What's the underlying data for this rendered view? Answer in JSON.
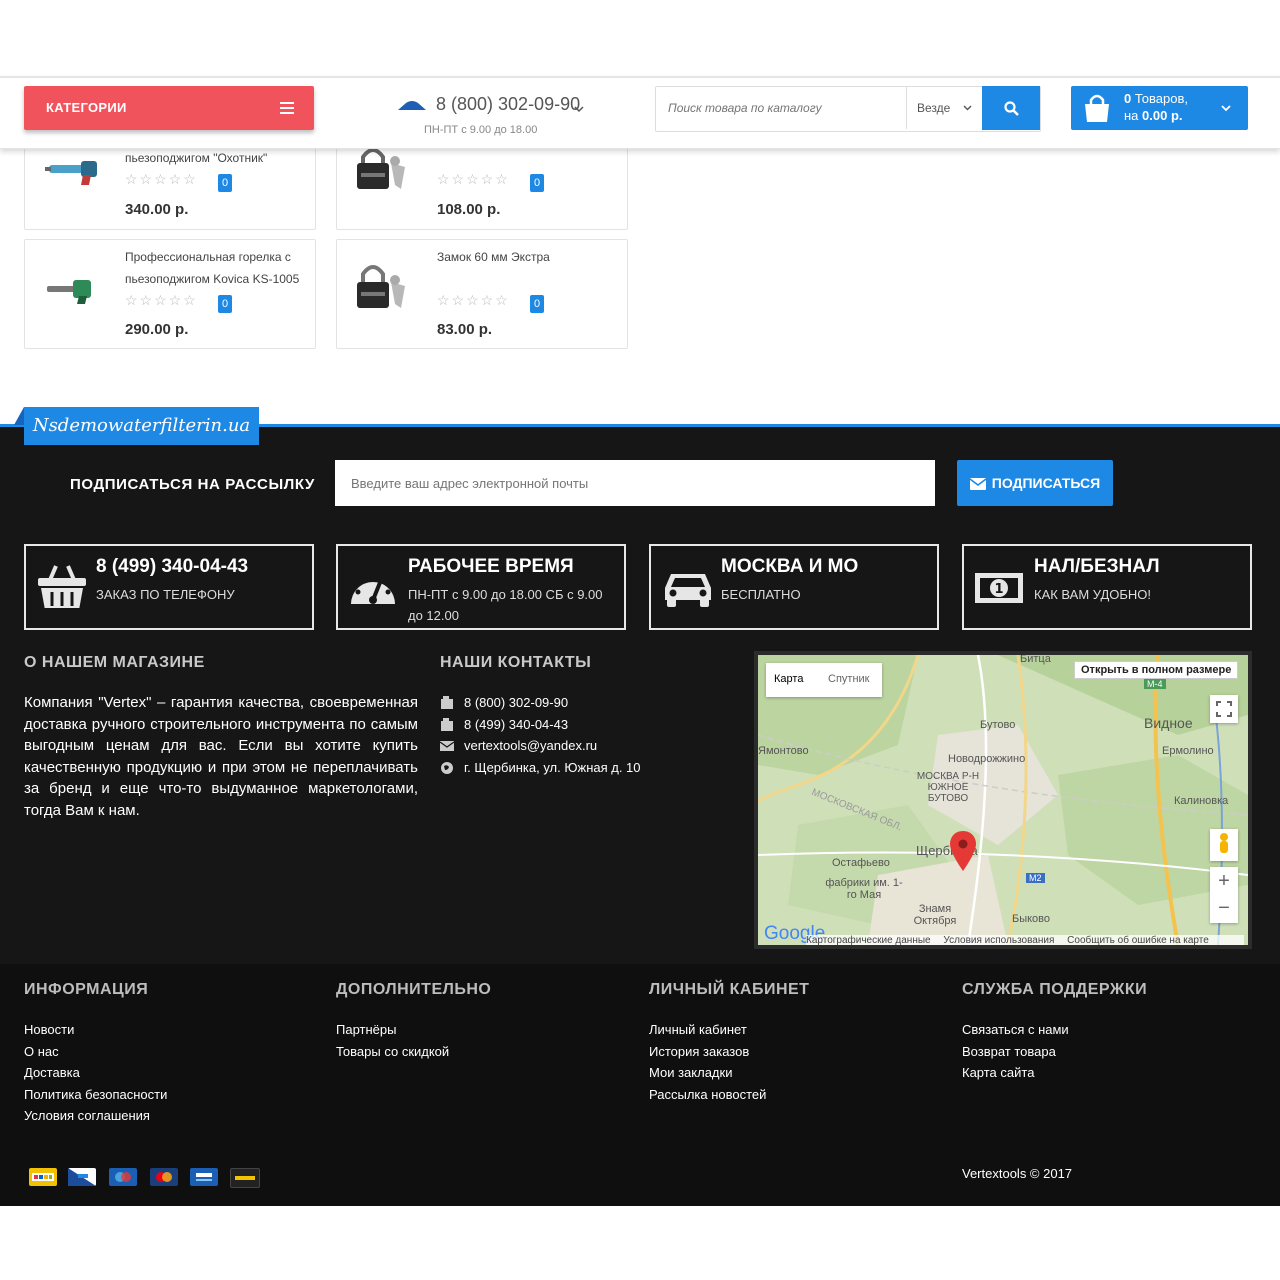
{
  "header": {
    "categories_label": "КАТЕГОРИИ",
    "phone": "8 (800) 302-09-90",
    "hours": "ПН-ПТ с 9.00 до 18.00",
    "search_placeholder": "Поиск товара по каталогу",
    "search_scope": "Везде",
    "cart_line1_count": "0",
    "cart_line1_text": " Товаров,",
    "cart_line2_prefix": "на ",
    "cart_line2_sum": "0.00 р."
  },
  "products": [
    {
      "name": "пьезоподжигом \"Охотник\"",
      "reviews": "0",
      "price": "340.00 р."
    },
    {
      "name": "",
      "reviews": "0",
      "price": "108.00 р."
    },
    {
      "name": "Профессиональная горелка с пьезоподжигом Kovica KS-1005",
      "reviews": "0",
      "price": "290.00 р."
    },
    {
      "name": "Замок 60 мм Экстра",
      "reviews": "0",
      "price": "83.00 р."
    }
  ],
  "footer": {
    "logo_text": "Nsdemowaterfilterin.ua",
    "newsletter_title": "ПОДПИСАТЬСЯ НА РАССЫЛКУ",
    "newsletter_placeholder": "Введите ваш адрес электронной почты",
    "subscribe_label": "ПОДПИСАТЬСЯ",
    "info_boxes": [
      {
        "title": "8 (499) 340-04-43",
        "sub": "ЗАКАЗ ПО ТЕЛЕФОНУ"
      },
      {
        "title": "РАБОЧЕЕ ВРЕМЯ",
        "sub": "ПН-ПТ с 9.00 до 18.00 СБ с 9.00 до 12.00"
      },
      {
        "title": "МОСКВА И МО",
        "sub": "БЕСПЛАТНО"
      },
      {
        "title": "НАЛ/БЕЗНАЛ",
        "sub": "КАК ВАМ УДОБНО!"
      }
    ],
    "about_title": "О НАШЕМ МАГАЗИНЕ",
    "about_text": "Компания \"Vertex\" – гарантия качества, своевременная доставка ручного строительного инструмента по самым выгодным ценам для вас. Если вы хотите купить качественную продукцию и при этом не переплачивать за бренд и еще что-то выдуманное маркетологами, тогда Вам к нам.",
    "contacts_title": "НАШИ КОНТАКТЫ",
    "contacts": [
      "8 (800) 302-09-90",
      "8 (499) 340-04-43",
      "vertextools@yandex.ru",
      "г. Щербинка, ул. Южная д. 10"
    ],
    "map": {
      "tab_map": "Карта",
      "tab_satellite": "Спутник",
      "fullscreen_link": "Открыть в полном размере",
      "places": [
        "Битца",
        "Бутово",
        "Видное",
        "Ямонтово",
        "Новодрожжино",
        "Ермолино",
        "МОСКВА Р-Н ЮЖНОЕ БУТОВО",
        "МОСКОВСКАЯ ОБЛ.",
        "Калиновка",
        "Щербинка",
        "Остафьево",
        "фабрики им. 1-го Мая",
        "Знамя Октября",
        "Быково",
        "М-4",
        "М2"
      ],
      "attribution": "Картографические данные",
      "terms": "Условия использования",
      "report": "Сообщить об ошибке на карте",
      "google": "Google"
    },
    "columns": [
      {
        "title": "ИНФОРМАЦИЯ",
        "links": [
          "Новости",
          "О нас",
          "Доставка",
          "Политика безопасности",
          "Условия соглашения"
        ]
      },
      {
        "title": "ДОПОЛНИТЕЛЬНО",
        "links": [
          "Партнёры",
          "Товары со скидкой"
        ]
      },
      {
        "title": "ЛИЧНЫЙ КАБИНЕТ",
        "links": [
          "Личный кабинет",
          "История заказов",
          "Мои закладки",
          "Рассылка новостей"
        ]
      },
      {
        "title": "СЛУЖБА ПОДДЕРЖКИ",
        "links": [
          "Связаться с нами",
          "Возврат товара",
          "Карта сайта"
        ]
      }
    ],
    "payment_icons": [
      "ebay-icon",
      "paypal-icon",
      "maestro-icon",
      "mastercard-icon",
      "visa-electron-icon",
      "card-icon"
    ],
    "copyright": "Vertextools © 2017"
  }
}
